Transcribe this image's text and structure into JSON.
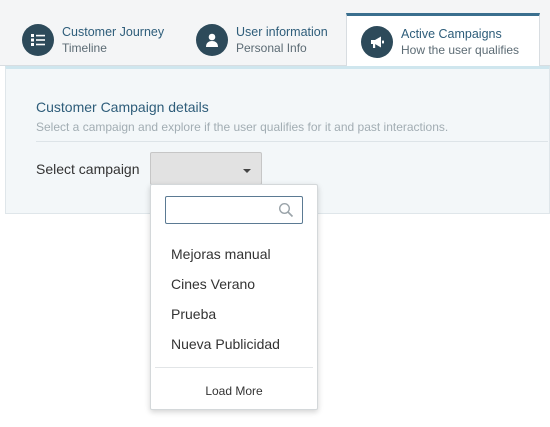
{
  "tabs": [
    {
      "title": "Customer Journey",
      "subtitle": "Timeline",
      "icon": "list-icon"
    },
    {
      "title": "User information",
      "subtitle": "Personal Info",
      "icon": "user-icon"
    },
    {
      "title": "Active Campaigns",
      "subtitle": "How the user qualifies",
      "icon": "megaphone-icon",
      "active": true
    }
  ],
  "panel": {
    "title": "Customer Campaign details",
    "subtitle": "Select a campaign and explore if the user qualifies for it and past interactions.",
    "select_label": "Select campaign",
    "selected_value": ""
  },
  "dropdown": {
    "search_value": "",
    "options": [
      "Mejoras manual",
      "Cines Verano",
      "Prueba",
      "Nueva Publicidad"
    ],
    "load_more": "Load More"
  },
  "colors": {
    "accent": "#2e5d7a",
    "icon_bg": "#2d4a5a",
    "search_border": "#5b7a93"
  }
}
